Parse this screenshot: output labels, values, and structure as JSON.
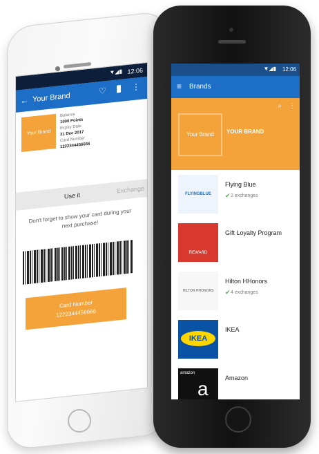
{
  "white_phone": {
    "status": {
      "time": "12:06"
    },
    "appbar": {
      "title": "Your Brand"
    },
    "card": {
      "logo_text": "Your Brand",
      "balance_label": "Balance",
      "balance_value": "1000 Points",
      "expiry_label": "Expiry Date",
      "expiry_value": "31 Dec 2017",
      "card_number_label": "Card Number",
      "card_number_value": "1222344456666"
    },
    "tabs": [
      "Use it",
      "Exchange"
    ],
    "message": "Don't forget to show your card during your next purchase!",
    "card_button": {
      "label": "Card Number",
      "number": "1222344456666"
    }
  },
  "black_phone": {
    "status": {
      "time": "12:06"
    },
    "appbar": {
      "title": "Brands"
    },
    "featured": {
      "logo_text": "Your Brand",
      "label": "YOUR BRAND"
    },
    "brands": [
      {
        "name": "Flying Blue",
        "logo": "FLYINGBLUE",
        "sub": "2 exchanges"
      },
      {
        "name": "Gift Loyalty Program",
        "logo": "REWARD",
        "sub": ""
      },
      {
        "name": "Hilton HHonors",
        "logo": "HILTON HHONORS",
        "sub": "4 exchanges"
      },
      {
        "name": "IKEA",
        "logo": "IKEA",
        "sub": ""
      },
      {
        "name": "Amazon",
        "logo": "amazon",
        "sub": ""
      }
    ]
  },
  "colors": {
    "blue": "#1d6ec6",
    "orange": "#f4a23a",
    "dark": "#0d1f3a"
  }
}
